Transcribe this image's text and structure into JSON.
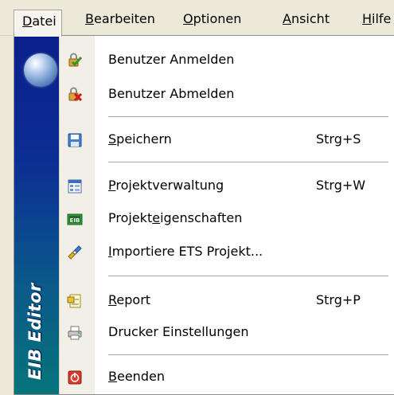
{
  "menubar": {
    "items": [
      {
        "label": "Datei",
        "underline": "D"
      },
      {
        "label": "Bearbeiten",
        "underline": "B"
      },
      {
        "label": "Optionen",
        "underline": "O"
      },
      {
        "label": "Ansicht",
        "underline": "A"
      },
      {
        "label": "Hilfe",
        "underline": "H"
      }
    ]
  },
  "sidebar": {
    "title": "EIB Editor"
  },
  "menu": {
    "items": [
      {
        "pre": "Benutzer Anmelden",
        "ul": "",
        "post": "",
        "shortcut": "",
        "icon": "user-login-icon"
      },
      {
        "pre": "Benutzer Abmelden",
        "ul": "",
        "post": "",
        "shortcut": "",
        "icon": "user-logout-icon"
      },
      {
        "pre": "",
        "ul": "S",
        "post": "peichern",
        "shortcut": "Strg+S",
        "icon": "save-icon"
      },
      {
        "pre": "",
        "ul": "P",
        "post": "rojektverwaltung",
        "shortcut": "Strg+W",
        "icon": "project-management-icon"
      },
      {
        "pre": "Projekt",
        "ul": "e",
        "post": "igenschaften",
        "shortcut": "",
        "icon": "project-properties-icon"
      },
      {
        "pre": "",
        "ul": "I",
        "post": "mportiere ETS Projekt...",
        "shortcut": "",
        "icon": "import-ets-icon"
      },
      {
        "pre": "",
        "ul": "R",
        "post": "eport",
        "shortcut": "Strg+P",
        "icon": "report-icon"
      },
      {
        "pre": "Drucker Einstellungen",
        "ul": "",
        "post": "",
        "shortcut": "",
        "icon": "printer-settings-icon"
      },
      {
        "pre": "",
        "ul": "B",
        "post": "eenden",
        "shortcut": "",
        "icon": "exit-icon"
      }
    ]
  },
  "colors": {
    "sidebar_top": "#0a1f8a",
    "sidebar_bottom": "#06747a",
    "separator": "#a7a7a7"
  }
}
